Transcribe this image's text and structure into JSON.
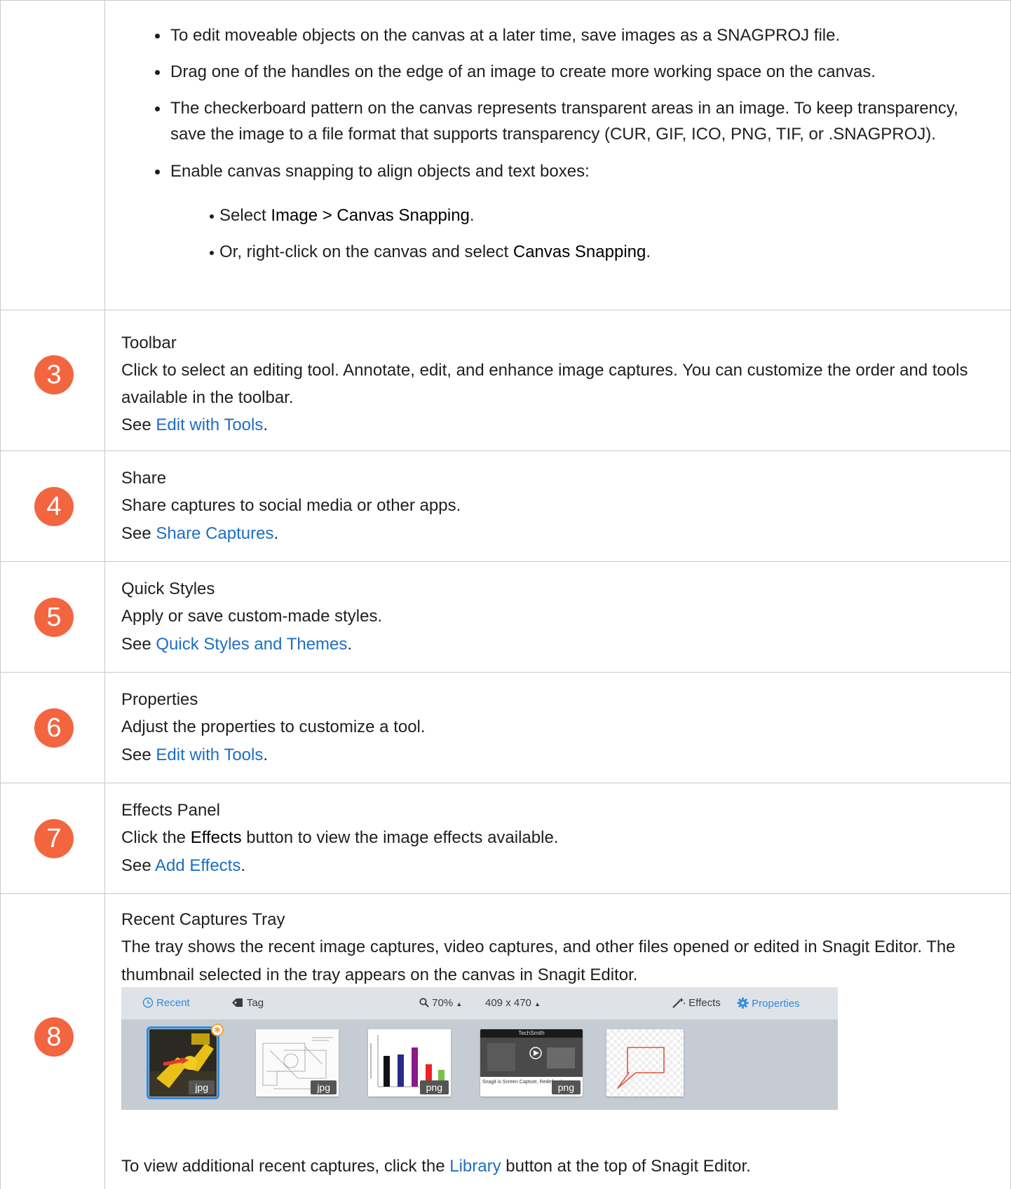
{
  "intro_bullets": [
    "To edit moveable objects on the canvas at a later time, save images as a SNAGPROJ file.",
    "Drag one of the handles on the edge of an image to create more working space on the canvas.",
    "The checkerboard pattern on the canvas represents transparent areas in an image. To keep transparency, save the image to a file format that supports transparency (CUR, GIF, ICO, PNG, TIF, or .SNAGPROJ).",
    "Enable canvas snapping to align objects and text boxes:"
  ],
  "sub_bullets": [
    {
      "pre": "Select ",
      "bold": "Image > Canvas Snapping",
      "post": "."
    },
    {
      "pre": "Or, right-click on the canvas and select ",
      "bold": "Canvas Snapping",
      "post": "."
    }
  ],
  "rows": [
    {
      "num": "3",
      "title": "Toolbar",
      "desc": "Click to select an editing tool. Annotate, edit, and enhance image captures. You can customize the order and tools available in the toolbar.",
      "see": "See ",
      "link": "Edit with Tools",
      "end": "."
    },
    {
      "num": "4",
      "title": "Share",
      "desc": "Share captures to social media or other apps.",
      "see": "See ",
      "link": "Share Captures",
      "end": "."
    },
    {
      "num": "5",
      "title": "Quick Styles",
      "desc": "Apply or save custom-made styles.",
      "see": "See ",
      "link": "Quick Styles and Themes",
      "end": "."
    },
    {
      "num": "6",
      "title": "Properties",
      "desc": "Adjust the properties to customize a tool.",
      "see": "See ",
      "link": "Edit with Tools",
      "end": "."
    },
    {
      "num": "7",
      "title": "Effects Panel",
      "desc_pre": "Click the ",
      "desc_bold": "Effects",
      "desc_post": " button to view the image effects available.",
      "see": "See ",
      "link": "Add Effects",
      "end": "."
    },
    {
      "num": "8",
      "title": "Recent Captures Tray",
      "desc": "The tray shows the recent image captures, video captures, and other files opened or edited in Snagit Editor. The thumbnail selected in the tray appears on the canvas in Snagit Editor.",
      "footer_pre": "To view additional recent captures, click the ",
      "footer_link": "Library",
      "footer_post": " button at the top of Snagit Editor."
    }
  ],
  "tray": {
    "recent": "Recent",
    "tag": "Tag",
    "zoom": "70%",
    "size": "409 x 470",
    "effects": "Effects",
    "properties": "Properties",
    "thumbs": [
      "jpg",
      "jpg",
      "png",
      "png"
    ],
    "video_caption": "Snagit is Screen Capture, Redefined",
    "video_brand": "TechSmith"
  },
  "colors": {
    "badge": "#f3653f",
    "link": "#1c6fc4",
    "border": "#c9c9c9"
  }
}
